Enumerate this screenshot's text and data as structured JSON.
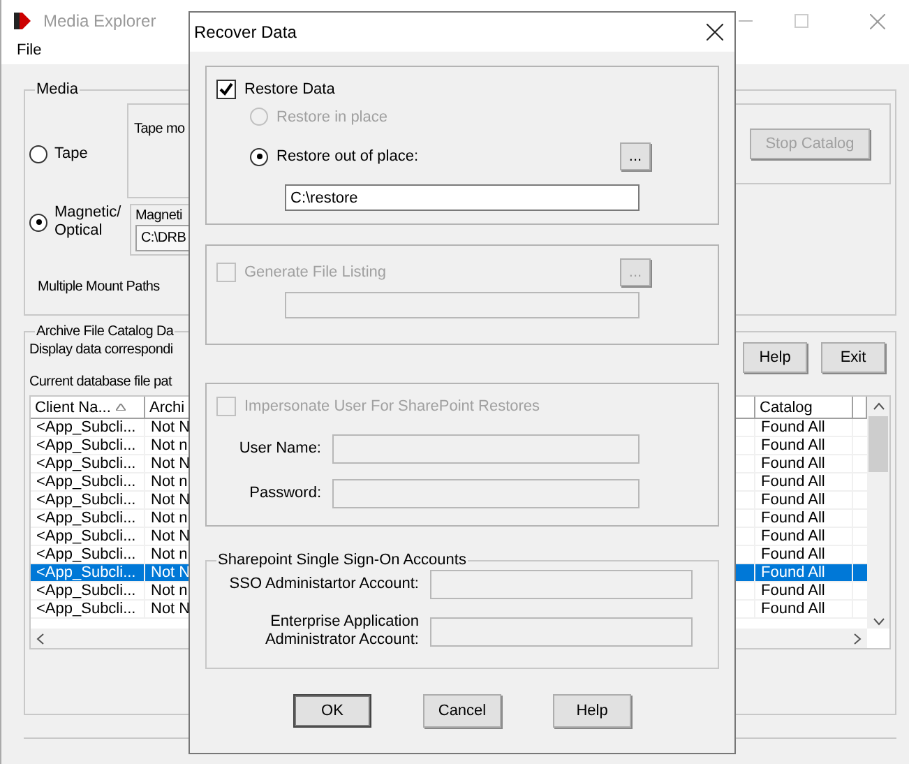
{
  "window": {
    "title": "Media Explorer"
  },
  "menu": [
    {
      "label": "File"
    }
  ],
  "media": {
    "legend": "Media",
    "options": [
      {
        "label": "Tape",
        "selected": false
      },
      {
        "label": "Magnetic/ Optical",
        "selected": true
      }
    ],
    "tape_box_label": "Tape mo",
    "magnetic_box_label": "Magneti",
    "magnetic_path": "C:\\DRB",
    "multiple_mount_paths": "Multiple Mount Paths",
    "stop_button": {
      "label": "Stop Catalog",
      "disabled": true
    }
  },
  "archive": {
    "legend": "Archive File Catalog Da",
    "display_text": "Display data correspondi",
    "path_text": "Current database file pat",
    "buttons": [
      "Help",
      "Exit"
    ],
    "table": {
      "columns": [
        {
          "label": "Client Na...",
          "sorted": true
        },
        {
          "label": "Archi"
        },
        {
          "label": "Catalog"
        }
      ],
      "rows": [
        {
          "client": "<App_Subcli...",
          "archive": "Not N",
          "catalog": "Found All",
          "selected": false
        },
        {
          "client": "<App_Subcli...",
          "archive": "Not n",
          "catalog": "Found All",
          "selected": false
        },
        {
          "client": "<App_Subcli...",
          "archive": "Not N",
          "catalog": "Found All",
          "selected": false
        },
        {
          "client": "<App_Subcli...",
          "archive": "Not n",
          "catalog": "Found All",
          "selected": false
        },
        {
          "client": "<App_Subcli...",
          "archive": "Not N",
          "catalog": "Found All",
          "selected": false
        },
        {
          "client": "<App_Subcli...",
          "archive": "Not n",
          "catalog": "Found All",
          "selected": false
        },
        {
          "client": "<App_Subcli...",
          "archive": "Not N",
          "catalog": "Found All",
          "selected": false
        },
        {
          "client": "<App_Subcli...",
          "archive": "Not n",
          "catalog": "Found All",
          "selected": false
        },
        {
          "client": "<App_Subcli...",
          "archive": "Not N",
          "catalog": "Found All",
          "selected": true
        },
        {
          "client": "<App_Subcli...",
          "archive": "Not n",
          "catalog": "Found All",
          "selected": false
        },
        {
          "client": "<App_Subcli...",
          "archive": "Not N",
          "catalog": "Found All",
          "selected": false
        }
      ]
    }
  },
  "dialog": {
    "title": "Recover Data",
    "restore": {
      "label": "Restore Data",
      "checked": true,
      "options": [
        {
          "label": "Restore in place",
          "selected": false,
          "disabled": true
        },
        {
          "label": "Restore out of place:",
          "selected": true,
          "disabled": false
        }
      ],
      "browse": "...",
      "path": "C:\\restore"
    },
    "file_listing": {
      "label": "Generate File Listing",
      "checked": false,
      "disabled": true,
      "browse": "..."
    },
    "impersonate": {
      "label": "Impersonate User For SharePoint Restores",
      "checked": false,
      "disabled": true,
      "fields": [
        {
          "label": "User Name:"
        },
        {
          "label": "Password:"
        }
      ]
    },
    "sso": {
      "legend": "Sharepoint Single Sign-On Accounts",
      "fields": [
        {
          "label": "SSO Administartor Account:"
        },
        {
          "label": "Enterprise Application Administrator Account:"
        }
      ]
    },
    "buttons": [
      "OK",
      "Cancel",
      "Help"
    ]
  }
}
